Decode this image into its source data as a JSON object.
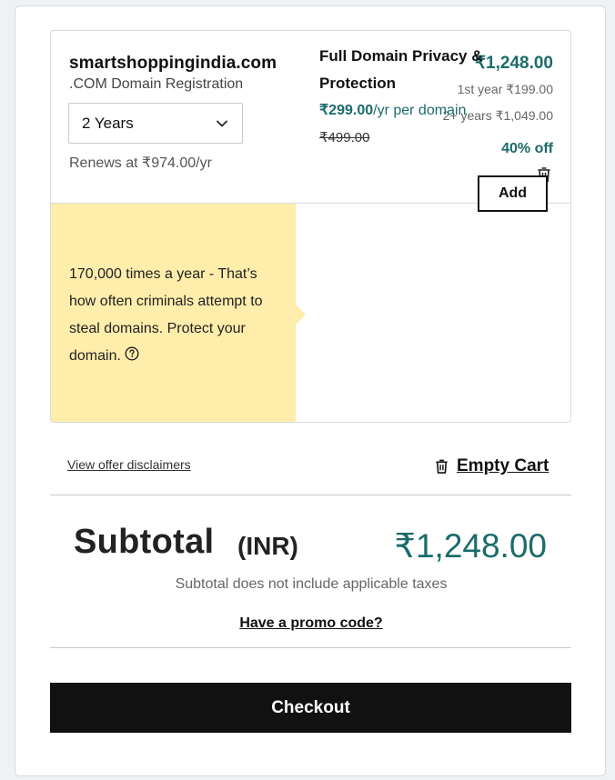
{
  "cart_item": {
    "domain_name": "smartshoppingindia.com",
    "product_type": ".COM Domain Registration",
    "term_selected": "2 Years",
    "renewal_text": "Renews at ₹974.00/yr",
    "price_total": "₹1,248.00",
    "price_first_year": "1st year ₹199.00",
    "price_subsequent": "2+ years ₹1,049.00",
    "discount_label": "40% off"
  },
  "upsell": {
    "promo_message": "170,000 times a year -  That’s how often criminals attempt to steal domains. Protect your domain.",
    "title": "Full Domain Privacy & Protection",
    "price": "₹299.00",
    "price_suffix": "/yr per domain",
    "original_price": "₹499.00",
    "add_label": "Add"
  },
  "links": {
    "disclaimers": "View offer disclaimers",
    "empty_cart": "Empty Cart"
  },
  "summary": {
    "subtotal_label": "Subtotal",
    "currency": "(INR)",
    "subtotal_amount": "₹1,248.00",
    "tax_note": "Subtotal does not include applicable taxes",
    "promo_link": "Have a promo code?"
  },
  "checkout_label": "Checkout",
  "colors": {
    "accent_teal": "#1b6b6b",
    "promo_yellow": "#ffedab",
    "checkout_black": "#111111"
  },
  "icons": [
    "chevron-down-icon",
    "trash-icon",
    "help-circle-icon"
  ]
}
